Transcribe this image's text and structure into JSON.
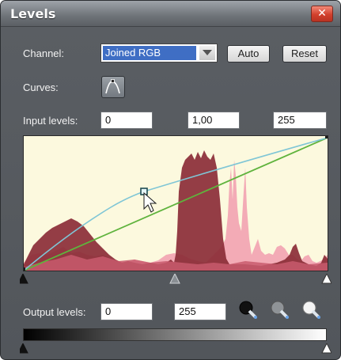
{
  "window": {
    "title": "Levels",
    "close_glyph": "✕"
  },
  "channel": {
    "label": "Channel:",
    "value": "Joined RGB"
  },
  "buttons": {
    "auto": "Auto",
    "reset": "Reset"
  },
  "curves": {
    "label": "Curves:",
    "icon": "curve-icon"
  },
  "input_levels": {
    "label": "Input levels:",
    "black": "0",
    "gamma": "1,00",
    "white": "255"
  },
  "output_levels": {
    "label": "Output levels:",
    "black": "0",
    "white": "255"
  },
  "pickers": [
    "black-point-picker-icon",
    "gray-point-picker-icon",
    "white-point-picker-icon"
  ],
  "colors": {
    "histogram_dark": "#8b2c37",
    "histogram_light": "#f2a7b3",
    "histogram_mid": "#c85a6d",
    "curve": "#7fc6d6",
    "diagonal": "#5fb33d",
    "graph_bg": "#fcf9de"
  }
}
